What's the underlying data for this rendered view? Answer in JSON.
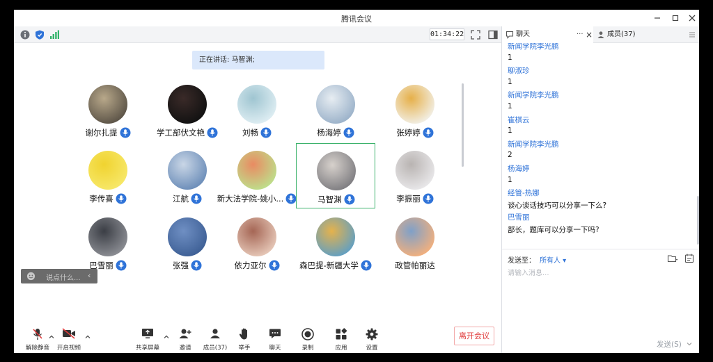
{
  "window": {
    "title": "腾讯会议",
    "controls": [
      "minimize-icon",
      "maximize-icon",
      "close-icon"
    ]
  },
  "meeting": {
    "timer": "01:34:22",
    "speaking_prefix": "正在讲话: ",
    "speaking_name": "马智渊;"
  },
  "participants": [
    {
      "name": "谢尔扎提",
      "mic": "on",
      "avatar": [
        "#5a5246",
        "#b8a88a"
      ]
    },
    {
      "name": "学工部伏文艳",
      "mic": "on",
      "avatar": [
        "#111111",
        "#3a2a28"
      ]
    },
    {
      "name": "刘畅",
      "mic": "on",
      "avatar": [
        "#dfeef3",
        "#9fc5d1"
      ]
    },
    {
      "name": "杨海婷",
      "mic": "on",
      "avatar": [
        "#9ab1c9",
        "#e7edf2"
      ]
    },
    {
      "name": "张婷婷",
      "mic": "on",
      "avatar": [
        "#f2f0e8",
        "#e6b04a"
      ]
    },
    {
      "name": "李传喜",
      "mic": "on",
      "avatar": [
        "#f7e86a",
        "#f0d330"
      ]
    },
    {
      "name": "江航",
      "mic": "on",
      "avatar": [
        "#6a8cb8",
        "#c9d6e6"
      ]
    },
    {
      "name": "新大法学院-姚小...",
      "mic": "on",
      "avatar": [
        "#bde08c",
        "#e98b62"
      ]
    },
    {
      "name": "马智渊",
      "mic": "on",
      "active": true,
      "avatar": [
        "#7d7c80",
        "#d7d1cc"
      ]
    },
    {
      "name": "李振丽",
      "mic": "on",
      "avatar": [
        "#e9e8ea",
        "#b9b4b2"
      ]
    },
    {
      "name": "巴雪丽",
      "mic": "on",
      "avatar": [
        "#8d8f95",
        "#3b3e45"
      ]
    },
    {
      "name": "张强",
      "mic": "on",
      "avatar": [
        "#3d5f95",
        "#6f8fc3"
      ]
    },
    {
      "name": "依力亚尔",
      "mic": "on",
      "avatar": [
        "#e7c9b9",
        "#a56655"
      ]
    },
    {
      "name": "森巴提-新疆大学",
      "mic": "on",
      "avatar": [
        "#5f9fc4",
        "#e5b24c"
      ]
    },
    {
      "name": "政管帕丽达",
      "mic": "none",
      "avatar": [
        "#f4b07c",
        "#7fa0c8"
      ]
    }
  ],
  "saybox": {
    "placeholder": "说点什么..."
  },
  "toolbar": {
    "items": [
      {
        "key": "unmute",
        "label": "解除静音"
      },
      {
        "key": "video",
        "label": "开启视频"
      },
      {
        "key": "share",
        "label": "共享屏幕"
      },
      {
        "key": "invite",
        "label": "邀请"
      },
      {
        "key": "members",
        "label": "成员(37)"
      },
      {
        "key": "raise",
        "label": "举手"
      },
      {
        "key": "chat",
        "label": "聊天"
      },
      {
        "key": "record",
        "label": "录制"
      },
      {
        "key": "apps",
        "label": "应用"
      },
      {
        "key": "settings",
        "label": "设置"
      }
    ],
    "leave_label": "离开会议"
  },
  "panel": {
    "chat_tab": "聊天",
    "more_label": "···",
    "members_tab": "成员(37)",
    "messages": [
      {
        "kind": "sender",
        "text": "新闻学院李光鹏"
      },
      {
        "kind": "text",
        "text": "1"
      },
      {
        "kind": "sender",
        "text": "聊淑珍"
      },
      {
        "kind": "text",
        "text": "1"
      },
      {
        "kind": "sender",
        "text": "新闻学院李光鹏"
      },
      {
        "kind": "text",
        "text": "1"
      },
      {
        "kind": "sender",
        "text": "崔棋云"
      },
      {
        "kind": "text",
        "text": "1"
      },
      {
        "kind": "sender",
        "text": "新闻学院李光鹏"
      },
      {
        "kind": "text",
        "text": "2"
      },
      {
        "kind": "sender",
        "text": "杨海婷"
      },
      {
        "kind": "text",
        "text": "1"
      },
      {
        "kind": "sender",
        "text": "经管-热娜"
      },
      {
        "kind": "text",
        "text": "谈心谈话技巧可以分享一下么?"
      },
      {
        "kind": "sender",
        "text": "巴雪丽"
      },
      {
        "kind": "text",
        "text": "部长，题库可以分享一下吗?"
      }
    ],
    "send_to_label": "发送至：",
    "send_to_value": "所有人 ▾",
    "input_placeholder": "请输入消息...",
    "send_label": "发送(S)"
  },
  "colors": {
    "accent": "#2f73d8",
    "active_border": "#3bb26b",
    "leave": "#e03b3b",
    "speaker_bg": "#dbe8fb"
  }
}
